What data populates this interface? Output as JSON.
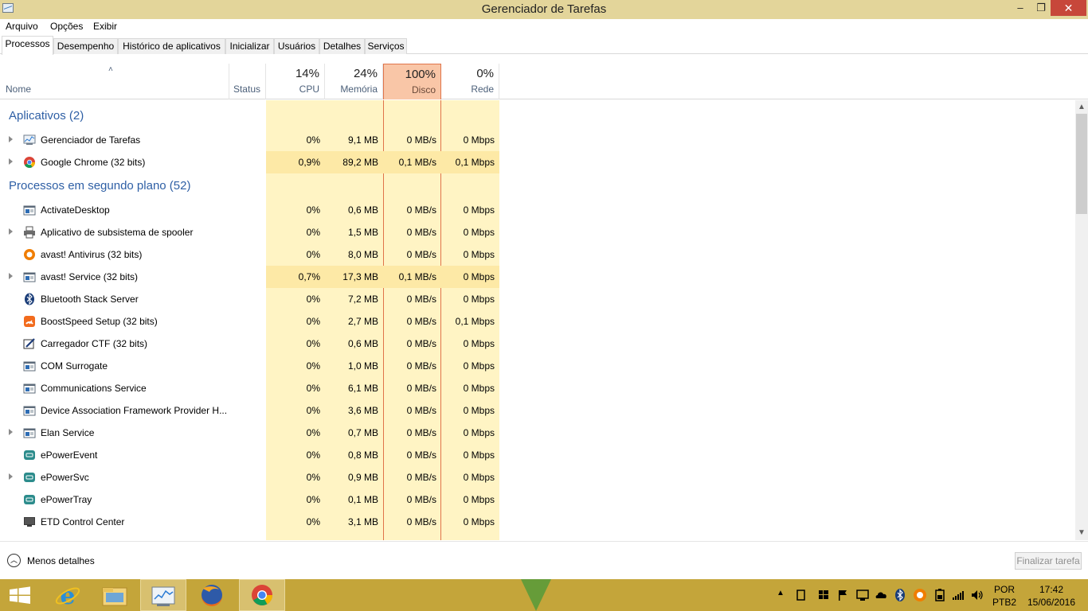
{
  "window": {
    "title": "Gerenciador de Tarefas",
    "minimize": "–",
    "maximize": "❐",
    "close": "✕"
  },
  "menu": [
    "Arquivo",
    "Opções",
    "Exibir"
  ],
  "tabs": [
    "Processos",
    "Desempenho",
    "Histórico de aplicativos",
    "Inicializar",
    "Usuários",
    "Detalhes",
    "Serviços"
  ],
  "active_tab": "Processos",
  "columns": {
    "name": "Nome",
    "status": "Status",
    "cpu": {
      "pct": "14%",
      "label": "CPU"
    },
    "memory": {
      "pct": "24%",
      "label": "Memória"
    },
    "disk": {
      "pct": "100%",
      "label": "Disco"
    },
    "network": {
      "pct": "0%",
      "label": "Rede"
    }
  },
  "groups": {
    "apps": "Aplicativos (2)",
    "background": "Processos em segundo plano (52)"
  },
  "apps": [
    {
      "name": "Gerenciador de Tarefas",
      "cpu": "0%",
      "mem": "9,1 MB",
      "disk": "0 MB/s",
      "net": "0 Mbps",
      "icon": "task-manager-icon",
      "expand": true
    },
    {
      "name": "Google Chrome (32 bits)",
      "cpu": "0,9%",
      "mem": "89,2 MB",
      "disk": "0,1 MB/s",
      "net": "0,1 Mbps",
      "icon": "chrome-icon",
      "expand": true
    }
  ],
  "background": [
    {
      "name": "ActivateDesktop",
      "cpu": "0%",
      "mem": "0,6 MB",
      "disk": "0 MB/s",
      "net": "0 Mbps",
      "icon": "service-window-icon",
      "expand": false
    },
    {
      "name": "Aplicativo de subsistema de spooler",
      "cpu": "0%",
      "mem": "1,5 MB",
      "disk": "0 MB/s",
      "net": "0 Mbps",
      "icon": "printer-icon",
      "expand": true
    },
    {
      "name": "avast! Antivirus (32 bits)",
      "cpu": "0%",
      "mem": "8,0 MB",
      "disk": "0 MB/s",
      "net": "0 Mbps",
      "icon": "avast-icon",
      "expand": false
    },
    {
      "name": "avast! Service (32 bits)",
      "cpu": "0,7%",
      "mem": "17,3 MB",
      "disk": "0,1 MB/s",
      "net": "0 Mbps",
      "icon": "service-window-icon",
      "expand": true
    },
    {
      "name": "Bluetooth Stack Server",
      "cpu": "0%",
      "mem": "7,2 MB",
      "disk": "0 MB/s",
      "net": "0 Mbps",
      "icon": "bluetooth-icon",
      "expand": false
    },
    {
      "name": "BoostSpeed Setup (32 bits)",
      "cpu": "0%",
      "mem": "2,7 MB",
      "disk": "0 MB/s",
      "net": "0,1 Mbps",
      "icon": "boostspeed-icon",
      "expand": false
    },
    {
      "name": "Carregador CTF (32 bits)",
      "cpu": "0%",
      "mem": "0,6 MB",
      "disk": "0 MB/s",
      "net": "0 Mbps",
      "icon": "ctf-pen-icon",
      "expand": false
    },
    {
      "name": "COM Surrogate",
      "cpu": "0%",
      "mem": "1,0 MB",
      "disk": "0 MB/s",
      "net": "0 Mbps",
      "icon": "service-window-icon",
      "expand": false
    },
    {
      "name": "Communications Service",
      "cpu": "0%",
      "mem": "6,1 MB",
      "disk": "0 MB/s",
      "net": "0 Mbps",
      "icon": "service-window-icon",
      "expand": false
    },
    {
      "name": "Device Association Framework Provider H...",
      "cpu": "0%",
      "mem": "3,6 MB",
      "disk": "0 MB/s",
      "net": "0 Mbps",
      "icon": "service-window-icon",
      "expand": false
    },
    {
      "name": "Elan Service",
      "cpu": "0%",
      "mem": "0,7 MB",
      "disk": "0 MB/s",
      "net": "0 Mbps",
      "icon": "service-window-icon",
      "expand": true
    },
    {
      "name": "ePowerEvent",
      "cpu": "0%",
      "mem": "0,8 MB",
      "disk": "0 MB/s",
      "net": "0 Mbps",
      "icon": "epower-icon",
      "expand": false
    },
    {
      "name": "ePowerSvc",
      "cpu": "0%",
      "mem": "0,9 MB",
      "disk": "0 MB/s",
      "net": "0 Mbps",
      "icon": "epower-icon",
      "expand": true
    },
    {
      "name": "ePowerTray",
      "cpu": "0%",
      "mem": "0,1 MB",
      "disk": "0 MB/s",
      "net": "0 Mbps",
      "icon": "epower-icon",
      "expand": false
    },
    {
      "name": "ETD Control Center",
      "cpu": "0%",
      "mem": "3,1 MB",
      "disk": "0 MB/s",
      "net": "0 Mbps",
      "icon": "monitor-icon",
      "expand": false
    }
  ],
  "footer": {
    "less_details": "Menos detalhes",
    "end_task": "Finalizar tarefa"
  },
  "taskbar": {
    "items": [
      "start-icon",
      "internet-explorer-icon",
      "file-explorer-icon",
      "task-manager-icon",
      "firefox-icon",
      "chrome-icon"
    ],
    "language": "POR",
    "layout": "PTB2",
    "time": "17:42",
    "date": "15/06/2016"
  },
  "colors": {
    "titlebar": "#e3d59a",
    "taskbar": "#c4a53a",
    "group_title": "#2e5fa5",
    "disk_header": "#f9c6a7"
  }
}
